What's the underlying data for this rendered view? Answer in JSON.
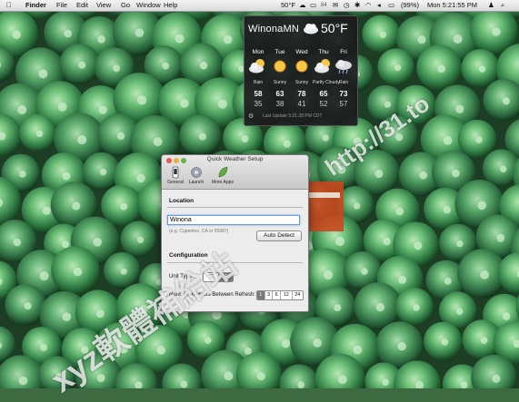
{
  "menubar": {
    "apple_icon": "apple-logo",
    "app_name": "Finder",
    "menus": [
      "File",
      "Edit",
      "View",
      "Go",
      "Window",
      "Help"
    ],
    "status_temp": "50°F",
    "battery": "(99%)",
    "clock": "Mon 5:21:55 PM"
  },
  "weather": {
    "city": "WinonaMN",
    "current_temp": "50°F",
    "current_icon": "cloud-icon",
    "days": [
      {
        "day": "Mon",
        "condition": "Rain",
        "high": "58",
        "low": "35",
        "icon": "cloud-sun-icon"
      },
      {
        "day": "Tue",
        "condition": "Sunny",
        "high": "63",
        "low": "38",
        "icon": "sun-icon"
      },
      {
        "day": "Wed",
        "condition": "Sunny",
        "high": "78",
        "low": "41",
        "icon": "sun-icon"
      },
      {
        "day": "Thu",
        "condition": "Partly Cloudy",
        "high": "65",
        "low": "52",
        "icon": "cloud-sun-icon"
      },
      {
        "day": "Fri",
        "condition": "Rain",
        "high": "73",
        "low": "57",
        "icon": "rain-icon"
      }
    ],
    "updated": "Last Update 5:21:28 PM CDT"
  },
  "setup": {
    "title": "Quick Weather Setup",
    "toolbar": [
      "General",
      "Launch",
      "More Apps"
    ],
    "location_heading": "Location",
    "location_value": "Winona",
    "location_hint": "(e.g. Cupertino, CA or 55987)",
    "auto_detect": "Auto Detect",
    "config_heading": "Configuration",
    "unit_label": "Unit Type:",
    "units": [
      "°C",
      "°F"
    ],
    "unit_selected": "°F",
    "hours_label": "Number of Hours Between Refresh:",
    "hours": [
      "1",
      "3",
      "6",
      "12",
      "24"
    ],
    "hours_selected": "1"
  },
  "watermark": {
    "url": "http://31.to",
    "text": "xyz軟體補給站"
  }
}
